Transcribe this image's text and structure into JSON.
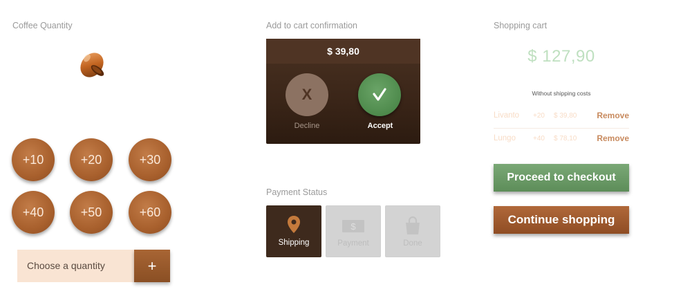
{
  "coffee_quantity": {
    "title": "Coffee Quantity",
    "buttons": [
      "+10",
      "+20",
      "+30",
      "+40",
      "+50",
      "+60"
    ],
    "select_placeholder": "Choose a quantity",
    "plus_label": "+"
  },
  "confirmation": {
    "title": "Add to cart confirmation",
    "price": "$ 39,80",
    "decline_symbol": "X",
    "decline_label": "Decline",
    "accept_label": "Accept"
  },
  "payment_status": {
    "title": "Payment Status",
    "steps": [
      {
        "label": "Shipping",
        "icon": "location-pin-icon",
        "active": true
      },
      {
        "label": "Payment",
        "icon": "money-icon",
        "active": false
      },
      {
        "label": "Done",
        "icon": "shopping-bag-icon",
        "active": false
      }
    ]
  },
  "shopping_cart": {
    "title": "Shopping cart",
    "total": "$ 127,90",
    "shipping_note": "Without shipping costs",
    "items": [
      {
        "name": "Livanto",
        "qty": "+20",
        "price": "$ 39,80",
        "remove": "Remove"
      },
      {
        "name": "Lungo",
        "qty": "+40",
        "price": "$ 78,10",
        "remove": "Remove"
      }
    ],
    "checkout_label": "Proceed to checkout",
    "continue_label": "Continue shopping"
  },
  "colors": {
    "brown_accent": "#a8602d",
    "dark_panel": "#3a2518",
    "green_accept": "#5d8d59",
    "total_green": "#bfe0c0",
    "select_bg": "#f9e4d3"
  }
}
